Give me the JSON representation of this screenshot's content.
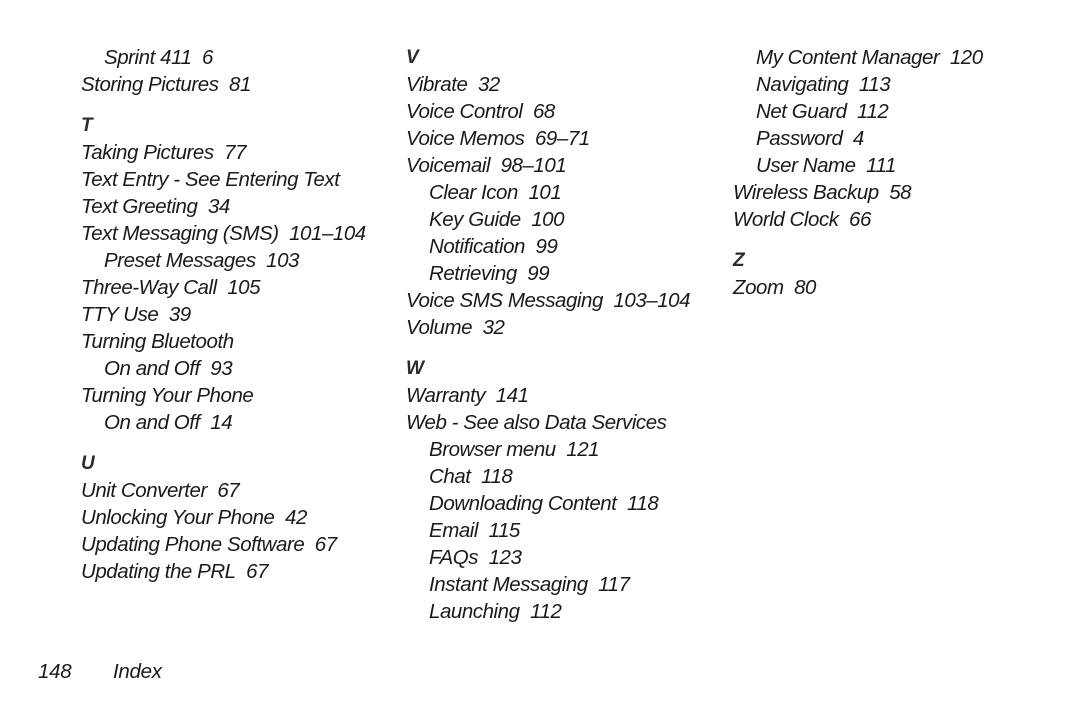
{
  "document": {
    "type": "book-index",
    "page_number": "148",
    "footer_label": "Index"
  },
  "columns": [
    {
      "id": "column-1",
      "groups": [
        {
          "letter": null,
          "entries": [
            {
              "text": "Sprint 411",
              "page_ref": "6",
              "level": 2
            },
            {
              "text": "Storing Pictures",
              "page_ref": "81",
              "level": 1
            }
          ]
        },
        {
          "letter": "T",
          "entries": [
            {
              "text": "Taking Pictures",
              "page_ref": "77",
              "level": 1
            },
            {
              "text": "Text Entry - See Entering Text",
              "page_ref": "",
              "level": 1
            },
            {
              "text": "Text Greeting",
              "page_ref": "34",
              "level": 1
            },
            {
              "text": "Text Messaging (SMS)",
              "page_ref": "101–104",
              "level": 1
            },
            {
              "text": "Preset Messages",
              "page_ref": "103",
              "level": 2
            },
            {
              "text": "Three-Way Call",
              "page_ref": "105",
              "level": 1
            },
            {
              "text": "TTY Use",
              "page_ref": "39",
              "level": 1
            },
            {
              "text": "Turning Bluetooth",
              "page_ref": "",
              "level": 1
            },
            {
              "text": "On and Off",
              "page_ref": "93",
              "level": 2
            },
            {
              "text": "Turning Your Phone",
              "page_ref": "",
              "level": 1
            },
            {
              "text": "On and Off",
              "page_ref": "14",
              "level": 2
            }
          ]
        },
        {
          "letter": "U",
          "entries": [
            {
              "text": "Unit Converter",
              "page_ref": "67",
              "level": 1
            },
            {
              "text": "Unlocking Your Phone",
              "page_ref": "42",
              "level": 1
            },
            {
              "text": "Updating Phone Software",
              "page_ref": "67",
              "level": 1
            },
            {
              "text": "Updating the PRL",
              "page_ref": "67",
              "level": 1
            }
          ]
        }
      ]
    },
    {
      "id": "column-2",
      "groups": [
        {
          "letter": "V",
          "entries": [
            {
              "text": "Vibrate",
              "page_ref": "32",
              "level": 1
            },
            {
              "text": "Voice Control",
              "page_ref": "68",
              "level": 1
            },
            {
              "text": "Voice Memos",
              "page_ref": "69–71",
              "level": 1
            },
            {
              "text": "Voicemail",
              "page_ref": "98–101",
              "level": 1
            },
            {
              "text": "Clear Icon",
              "page_ref": "101",
              "level": 2
            },
            {
              "text": "Key Guide",
              "page_ref": "100",
              "level": 2
            },
            {
              "text": "Notification",
              "page_ref": "99",
              "level": 2
            },
            {
              "text": "Retrieving",
              "page_ref": "99",
              "level": 2
            },
            {
              "text": "Voice SMS Messaging",
              "page_ref": "103–104",
              "level": 1
            },
            {
              "text": "Volume",
              "page_ref": "32",
              "level": 1
            }
          ]
        },
        {
          "letter": "W",
          "entries": [
            {
              "text": "Warranty",
              "page_ref": "141",
              "level": 1
            },
            {
              "text": "Web - See also Data Services",
              "page_ref": "",
              "level": 1
            },
            {
              "text": "Browser menu",
              "page_ref": "121",
              "level": 2
            },
            {
              "text": "Chat",
              "page_ref": "118",
              "level": 2
            },
            {
              "text": "Downloading Content",
              "page_ref": "118",
              "level": 2
            },
            {
              "text": "Email",
              "page_ref": "115",
              "level": 2
            },
            {
              "text": "FAQs",
              "page_ref": "123",
              "level": 2
            },
            {
              "text": "Instant Messaging",
              "page_ref": "117",
              "level": 2
            },
            {
              "text": "Launching",
              "page_ref": "112",
              "level": 2
            }
          ]
        }
      ]
    },
    {
      "id": "column-3",
      "groups": [
        {
          "letter": null,
          "entries": [
            {
              "text": "My Content Manager",
              "page_ref": "120",
              "level": 2
            },
            {
              "text": "Navigating",
              "page_ref": "113",
              "level": 2
            },
            {
              "text": "Net Guard",
              "page_ref": "112",
              "level": 2
            },
            {
              "text": "Password",
              "page_ref": "4",
              "level": 2
            },
            {
              "text": "User Name",
              "page_ref": "111",
              "level": 2
            },
            {
              "text": "Wireless Backup",
              "page_ref": "58",
              "level": 1
            },
            {
              "text": "World Clock",
              "page_ref": "66",
              "level": 1
            }
          ]
        },
        {
          "letter": "Z",
          "entries": [
            {
              "text": "Zoom",
              "page_ref": "80",
              "level": 1
            }
          ]
        }
      ]
    }
  ],
  "colors": {
    "page_background": "#ffffff",
    "body_text": "#1a1a1a",
    "letter_heading": "#2b2b2b"
  }
}
